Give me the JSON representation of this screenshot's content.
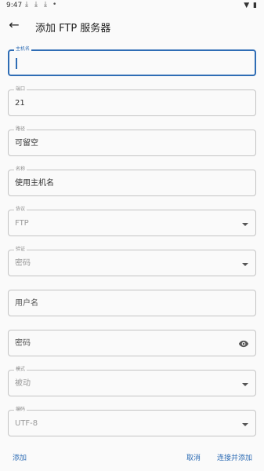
{
  "status_bar": {
    "time": "9:47",
    "download_icons": [
      "download-icon",
      "download-icon",
      "download-icon"
    ],
    "right_icons": [
      "wifi-icon",
      "battery-icon"
    ]
  },
  "app_bar": {
    "title": "添加 FTP 服务器",
    "back_icon": "arrow-back-icon"
  },
  "form": {
    "host": {
      "label": "主机名",
      "value": ""
    },
    "port": {
      "label": "端口",
      "value": "21"
    },
    "path": {
      "label": "路径",
      "value": "可留空"
    },
    "name": {
      "label": "名称",
      "value": "使用主机名"
    },
    "protocol": {
      "label": "协议",
      "value": "FTP"
    },
    "auth": {
      "label": "验证",
      "value": "密码"
    },
    "username": {
      "placeholder": "用户名"
    },
    "password": {
      "placeholder": "密码"
    },
    "mode": {
      "label": "模式",
      "value": "被动"
    },
    "encoding": {
      "label": "编码",
      "value": "UTF-8"
    }
  },
  "bottom_bar": {
    "add_label": "添加",
    "cancel_label": "取消",
    "connect_label": "连接并添加"
  },
  "colors": {
    "accent": "#2f6db5",
    "outline": "#c4c4c4",
    "background": "#fafafa"
  }
}
